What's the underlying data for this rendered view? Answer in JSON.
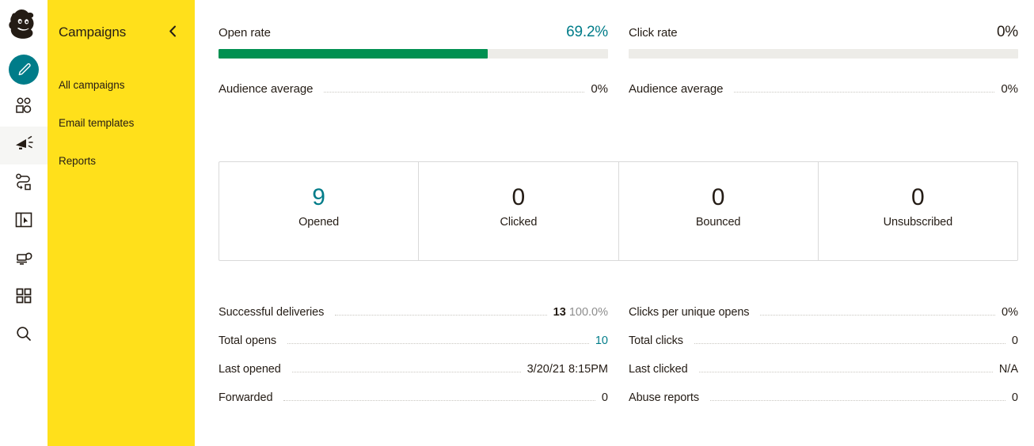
{
  "app": {
    "brand": "Mailchimp",
    "accent_teal": "#007C89",
    "brand_yellow": "#FFE01B",
    "bar_green": "#009051",
    "bar_track": "#EDECE8"
  },
  "icon_rail": {
    "logo_name": "mailchimp-freddie-logo",
    "items": [
      {
        "icon": "pencil-create-icon",
        "name": "create-button",
        "active": false
      },
      {
        "icon": "audience-people-icon",
        "name": "audience-nav",
        "active": false
      },
      {
        "icon": "megaphone-campaigns-icon",
        "name": "campaigns-nav",
        "active": true
      },
      {
        "icon": "automations-journey-icon",
        "name": "automations-nav",
        "active": false
      },
      {
        "icon": "website-page-icon",
        "name": "website-nav",
        "active": false
      },
      {
        "icon": "content-studio-icon",
        "name": "content-nav",
        "active": false
      },
      {
        "icon": "grid-apps-icon",
        "name": "integrations-nav",
        "active": false
      },
      {
        "icon": "search-icon",
        "name": "search-nav",
        "active": false
      }
    ]
  },
  "nav_panel": {
    "title": "Campaigns",
    "collapse_icon": "chevron-left-icon",
    "items": [
      {
        "label": "All campaigns"
      },
      {
        "label": "Email templates"
      },
      {
        "label": "Reports"
      }
    ]
  },
  "rates": [
    {
      "label": "Open rate",
      "value": "69.2%",
      "percent": 69.2,
      "accent": true,
      "average_label": "Audience average",
      "average_value": "0%"
    },
    {
      "label": "Click rate",
      "value": "0%",
      "percent": 0,
      "accent": false,
      "average_label": "Audience average",
      "average_value": "0%"
    }
  ],
  "cards": [
    {
      "number": "9",
      "label": "Opened",
      "accent": true
    },
    {
      "number": "0",
      "label": "Clicked",
      "accent": false
    },
    {
      "number": "0",
      "label": "Bounced",
      "accent": false
    },
    {
      "number": "0",
      "label": "Unsubscribed",
      "accent": false
    }
  ],
  "stats_left": [
    {
      "label": "Successful deliveries",
      "value": "13",
      "sub": "100.0%",
      "accent": false,
      "bold": true
    },
    {
      "label": "Total opens",
      "value": "10",
      "sub": "",
      "accent": true,
      "bold": false
    },
    {
      "label": "Last opened",
      "value": "3/20/21 8:15PM",
      "sub": "",
      "accent": false,
      "bold": false
    },
    {
      "label": "Forwarded",
      "value": "0",
      "sub": "",
      "accent": false,
      "bold": false
    }
  ],
  "stats_right": [
    {
      "label": "Clicks per unique opens",
      "value": "0%",
      "sub": "",
      "accent": false,
      "bold": false
    },
    {
      "label": "Total clicks",
      "value": "0",
      "sub": "",
      "accent": false,
      "bold": false
    },
    {
      "label": "Last clicked",
      "value": "N/A",
      "sub": "",
      "accent": false,
      "bold": false
    },
    {
      "label": "Abuse reports",
      "value": "0",
      "sub": "",
      "accent": false,
      "bold": false
    }
  ]
}
